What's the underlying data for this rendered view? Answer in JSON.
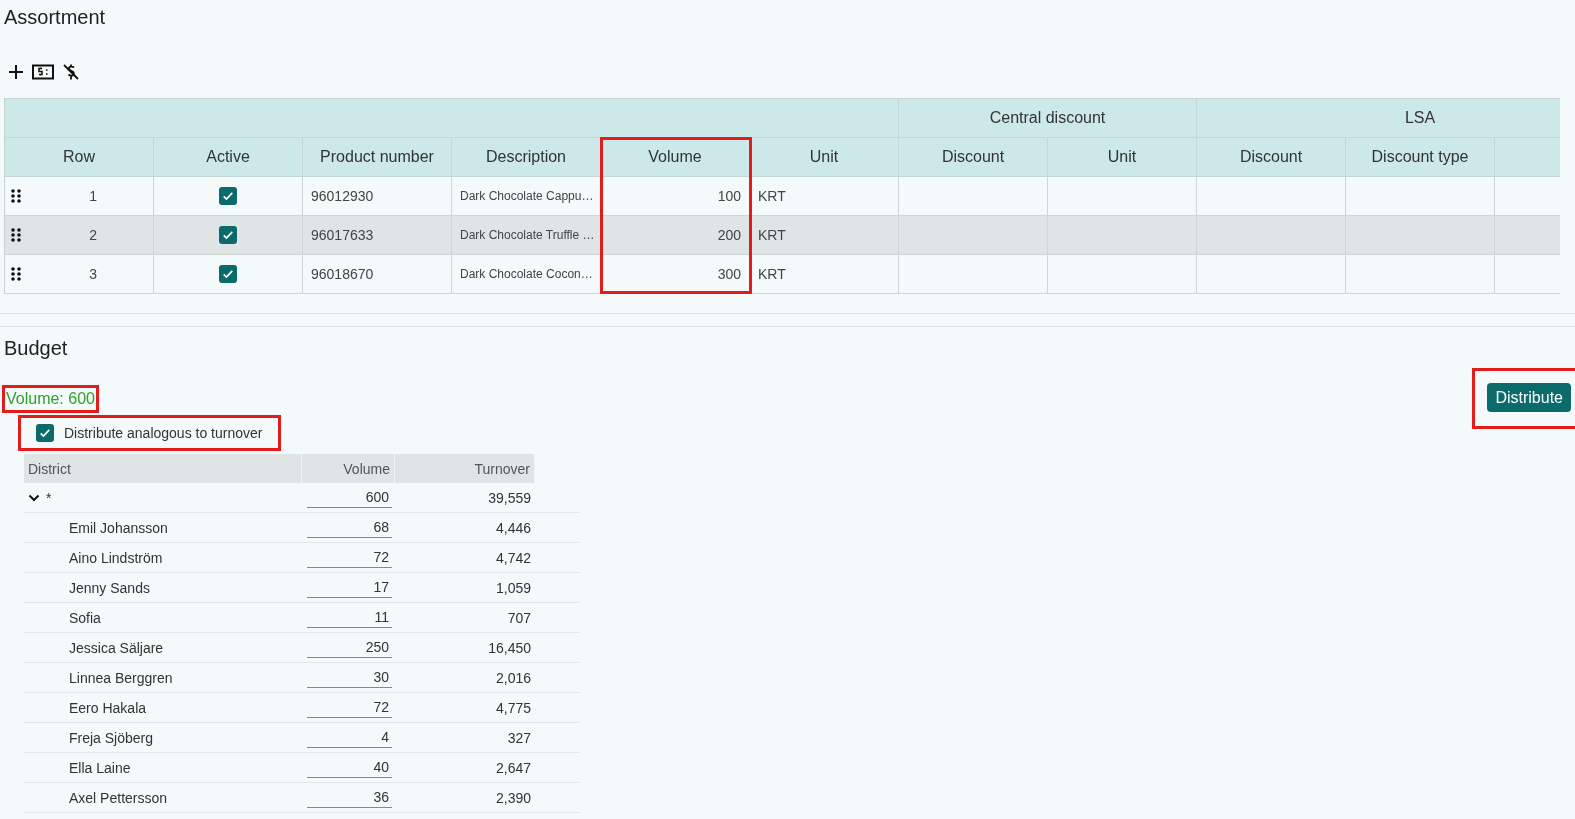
{
  "assortment": {
    "title": "Assortment",
    "columns": [
      {
        "label": "Row",
        "highlighted": false
      },
      {
        "label": "Active",
        "highlighted": false
      },
      {
        "label": "Product number",
        "highlighted": false
      },
      {
        "label": "Description",
        "highlighted": false
      },
      {
        "label": "Volume",
        "highlighted": true
      },
      {
        "label": "Unit",
        "highlighted": false
      }
    ],
    "column_groups": [
      {
        "label": "Central discount",
        "columns": [
          {
            "label": "Discount",
            "highlighted": false
          },
          {
            "label": "Unit",
            "highlighted": false
          }
        ]
      },
      {
        "label": "LSA",
        "columns": [
          {
            "label": "Discount",
            "highlighted": false
          },
          {
            "label": "Discount type",
            "highlighted": false
          }
        ]
      }
    ],
    "rows": [
      {
        "row": "1",
        "active": true,
        "product_number": "96012930",
        "description": "Dark Chocolate Cappu…",
        "volume": "100",
        "unit": "KRT",
        "selected": false
      },
      {
        "row": "2",
        "active": true,
        "product_number": "96017633",
        "description": "Dark Chocolate Truffle …",
        "volume": "200",
        "unit": "KRT",
        "selected": true
      },
      {
        "row": "3",
        "active": true,
        "product_number": "96018670",
        "description": "Dark Chocolate Cocon…",
        "volume": "300",
        "unit": "KRT",
        "selected": false
      }
    ]
  },
  "budget": {
    "title": "Budget",
    "total": {
      "text": "Volume: 600",
      "highlighted": true
    },
    "distribute_button": {
      "label": "Distribute",
      "highlighted": true
    },
    "analogous": {
      "label": "Distribute analogous to turnover",
      "checked": true,
      "highlighted": true
    },
    "table": {
      "columns": [
        "District",
        "Volume",
        "Turnover"
      ],
      "rows": [
        {
          "district": "*",
          "volume": "600",
          "turnover": "39,559",
          "expanded": true,
          "children": [
            {
              "district": "Emil Johansson",
              "volume": "68",
              "turnover": "4,446"
            },
            {
              "district": "Aino Lindström",
              "volume": "72",
              "turnover": "4,742"
            },
            {
              "district": "Jenny Sands",
              "volume": "17",
              "turnover": "1,059"
            },
            {
              "district": "Sofia",
              "volume": "11",
              "turnover": "707"
            },
            {
              "district": "Jessica Säljare",
              "volume": "250",
              "turnover": "16,450"
            },
            {
              "district": "Linnea Berggren",
              "volume": "30",
              "turnover": "2,016"
            },
            {
              "district": "Eero Hakala",
              "volume": "72",
              "turnover": "4,775"
            },
            {
              "district": "Freja Sjöberg",
              "volume": "4",
              "turnover": "327"
            },
            {
              "district": "Ella Laine",
              "volume": "40",
              "turnover": "2,647"
            },
            {
              "district": "Axel Pettersson",
              "volume": "36",
              "turnover": "2,390"
            }
          ]
        }
      ]
    }
  }
}
